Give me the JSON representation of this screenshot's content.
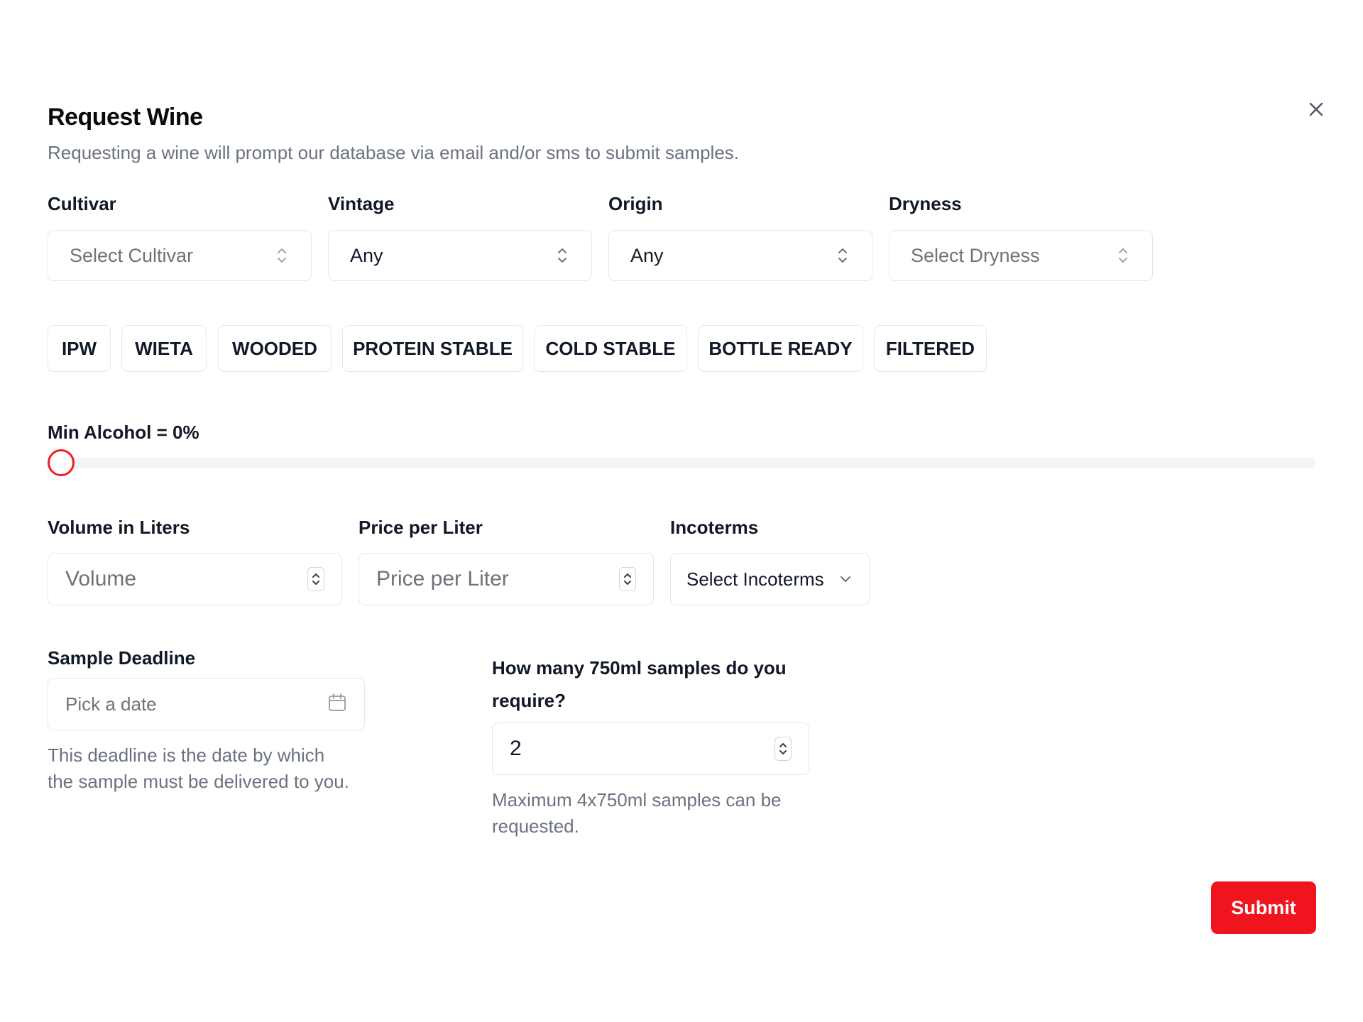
{
  "dialog": {
    "title": "Request Wine",
    "subtitle": "Requesting a wine will prompt our database via email and/or sms to submit samples.",
    "close_icon": "close-icon"
  },
  "filters": {
    "cultivar": {
      "label": "Cultivar",
      "value": "Select Cultivar"
    },
    "vintage": {
      "label": "Vintage",
      "value": "Any"
    },
    "origin": {
      "label": "Origin",
      "value": "Any"
    },
    "dryness": {
      "label": "Dryness",
      "value": "Select Dryness"
    }
  },
  "tags": [
    "IPW",
    "WIETA",
    "WOODED",
    "PROTEIN STABLE",
    "COLD STABLE",
    "BOTTLE READY",
    "FILTERED"
  ],
  "alcohol": {
    "label": "Min Alcohol = 0%",
    "value": 0
  },
  "volume": {
    "label": "Volume in Liters",
    "placeholder": "Volume"
  },
  "price": {
    "label": "Price per Liter",
    "placeholder": "Price per Liter"
  },
  "incoterms": {
    "label": "Incoterms",
    "value": "Select Incoterms"
  },
  "deadline": {
    "label": "Sample Deadline",
    "placeholder": "Pick a date",
    "helper_line1": "This deadline is the date by which",
    "helper_line2": "the sample must be delivered to you."
  },
  "samples": {
    "label_line1": "How many 750ml samples do you",
    "label_line2": "require?",
    "value": "2",
    "helper_line1": "Maximum 4x750ml samples can be",
    "helper_line2": "requested."
  },
  "actions": {
    "submit": "Submit"
  },
  "colors": {
    "accent": "#f0141e",
    "border": "#e5e7eb",
    "muted": "#6b7280"
  }
}
